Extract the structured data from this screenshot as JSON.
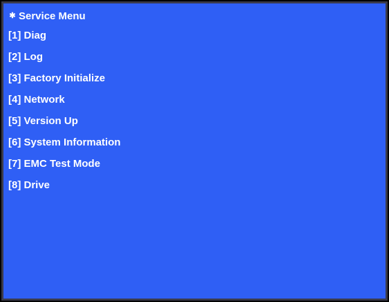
{
  "window": {
    "title": "Service Menu",
    "title_icon": "asterisk-icon"
  },
  "menu": {
    "items": [
      {
        "label": "[1] Diag"
      },
      {
        "label": "[2] Log"
      },
      {
        "label": "[3] Factory Initialize"
      },
      {
        "label": "[4] Network"
      },
      {
        "label": "[5] Version Up"
      },
      {
        "label": "[6] System Information"
      },
      {
        "label": "[7] EMC Test Mode"
      },
      {
        "label": "[8] Drive"
      }
    ]
  },
  "colors": {
    "background": "#2f5ff5",
    "text": "#ffffff",
    "frame": "#000000"
  }
}
